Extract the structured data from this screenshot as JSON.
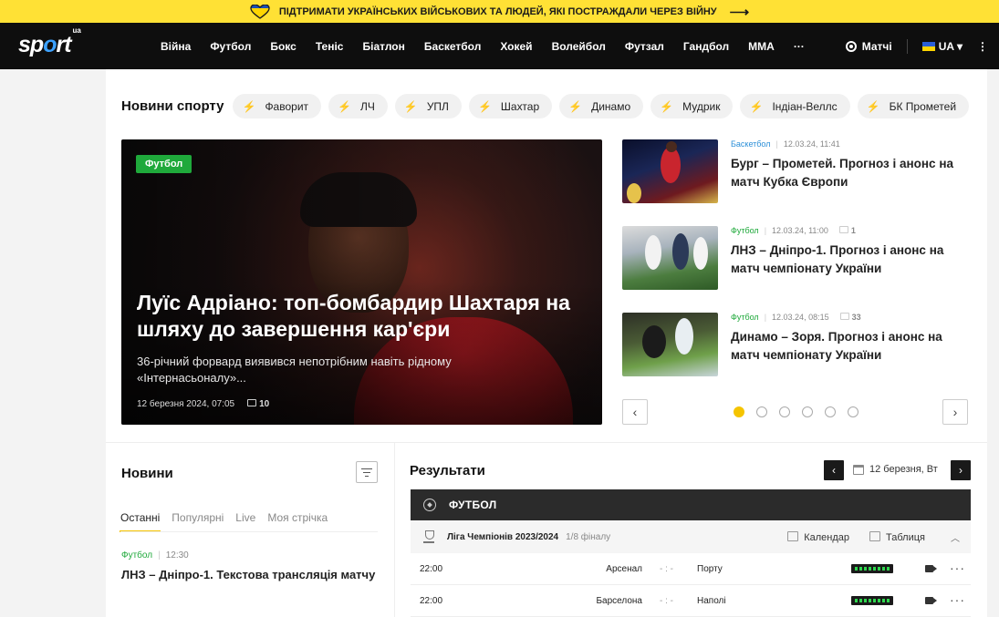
{
  "banner": {
    "text": "ПІДТРИМАТИ УКРАЇНСЬКИХ ВІЙСЬКОВИХ ТА ЛЮДЕЙ, ЯКІ ПОСТРАЖДАЛИ ЧЕРЕЗ ВІЙНУ",
    "arrow": "⟶"
  },
  "header": {
    "logo_text": "sp",
    "logo_o": "o",
    "logo_rest": "rt",
    "logo_sup": "ua",
    "nav": [
      "Війна",
      "Футбол",
      "Бокс",
      "Теніс",
      "Біатлон",
      "Баскетбол",
      "Хокей",
      "Волейбол",
      "Футзал",
      "Гандбол",
      "ММА",
      "···"
    ],
    "matches_label": "Матчі",
    "lang_label": "UA",
    "lang_chevron": "▾",
    "more_right": "⋮"
  },
  "tags": {
    "title": "Новини спорту",
    "items": [
      "Фаворит",
      "ЛЧ",
      "УПЛ",
      "Шахтар",
      "Динамо",
      "Мудрик",
      "Індіан-Веллс",
      "БК Прометей"
    ],
    "bolt": "⚡"
  },
  "hero": {
    "category": "Футбол",
    "title": "Луїс Адріано: топ-бомбардир Шахтаря на шляху до завершення кар'єри",
    "subtitle": "36-річний форвард виявився непотрібним навіть рідному «Інтернасьоналу»...",
    "date": "12 березня 2024, 07:05",
    "comments": "10"
  },
  "side_news": [
    {
      "category": "Баскетбол",
      "date": "12.03.24, 11:41",
      "comments": "",
      "title": "Бург – Прометей. Прогноз і анонс на матч Кубка Європи"
    },
    {
      "category": "Футбол",
      "date": "12.03.24, 11:00",
      "comments": "1",
      "title": "ЛНЗ – Дніпро-1. Прогноз і анонс на матч чемпіонату України"
    },
    {
      "category": "Футбол",
      "date": "12.03.24, 08:15",
      "comments": "33",
      "title": "Динамо – Зоря. Прогноз і анонс на матч чемпіонату України"
    }
  ],
  "carousel": {
    "prev": "‹",
    "next": "›",
    "total": 6,
    "active_index": 0
  },
  "news_panel": {
    "title": "Новини",
    "tabs": [
      "Останні",
      "Популярні",
      "Live",
      "Моя стрічка"
    ],
    "active_tab": "Останні",
    "item": {
      "category": "Футбол",
      "time": "12:30",
      "title": "ЛНЗ – Дніпро-1. Текстова трансляція матчу"
    }
  },
  "results": {
    "title": "Результати",
    "prev": "‹",
    "next": "›",
    "date": "12 березня, Вт",
    "sport": "ФУТБОЛ",
    "league": "Ліга Чемпіонів 2023/2024",
    "stage": "1/8 фіналу",
    "calendar_label": "Календар",
    "table_label": "Таблиця",
    "collapse": "︿",
    "matches": [
      {
        "time": "22:00",
        "home": "Арсенал",
        "score": "- : -",
        "away": "Порту",
        "more": "···"
      },
      {
        "time": "22:00",
        "home": "Барселона",
        "score": "- : -",
        "away": "Наполі",
        "more": "···"
      }
    ]
  },
  "colors": {
    "banner_bg": "#ffe135",
    "nav_bg": "#0e0e0e",
    "accent_yellow": "#f5c400",
    "category_green": "#1fa93b",
    "category_blue": "#2b8fd8",
    "logo_blue": "#3da2ff"
  }
}
